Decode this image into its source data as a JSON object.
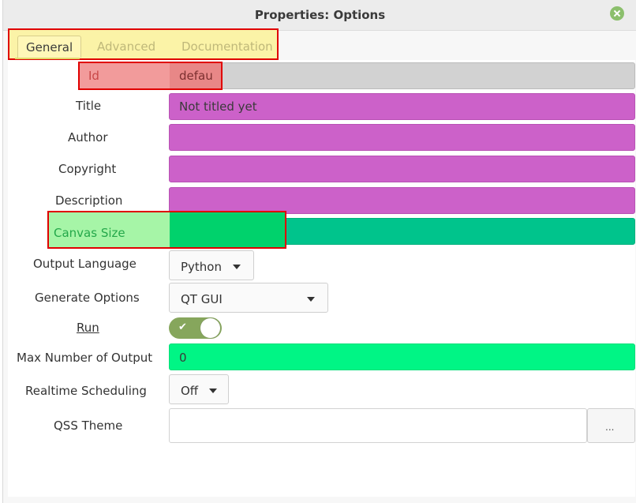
{
  "window": {
    "title": "Properties: Options"
  },
  "tabs": [
    {
      "label": "General",
      "active": true
    },
    {
      "label": "Advanced",
      "active": false
    },
    {
      "label": "Documentation",
      "active": false
    }
  ],
  "fields": {
    "id": {
      "label": "Id",
      "value": "defau"
    },
    "title": {
      "label": "Title",
      "value": "Not titled yet"
    },
    "author": {
      "label": "Author",
      "value": ""
    },
    "copyright": {
      "label": "Copyright",
      "value": ""
    },
    "description": {
      "label": "Description",
      "value": ""
    },
    "canvas_size": {
      "label": "Canvas Size",
      "value": ""
    },
    "output_language": {
      "label": "Output Language",
      "value": "Python"
    },
    "generate_options": {
      "label": "Generate Options",
      "value": "QT GUI"
    },
    "run": {
      "label": "Run",
      "enabled": true
    },
    "max_outputs": {
      "label": "Max Number of Output",
      "value": "0"
    },
    "realtime_scheduling": {
      "label": "Realtime Scheduling",
      "value": "Off"
    },
    "qss_theme": {
      "label": "QSS Theme",
      "value": "",
      "browse_label": "..."
    }
  },
  "icons": {
    "close": "close-icon",
    "dropdown": "chevron-down-icon",
    "switch_check": "check-icon"
  },
  "colors": {
    "magenta_field": "#cc61c9",
    "canvas_field": "#00c48c",
    "max_output_field": "#00f585",
    "toggle_on": "#86a65c",
    "highlight_border": "#e00000",
    "tabs_highlight": "#fbf3a7"
  }
}
